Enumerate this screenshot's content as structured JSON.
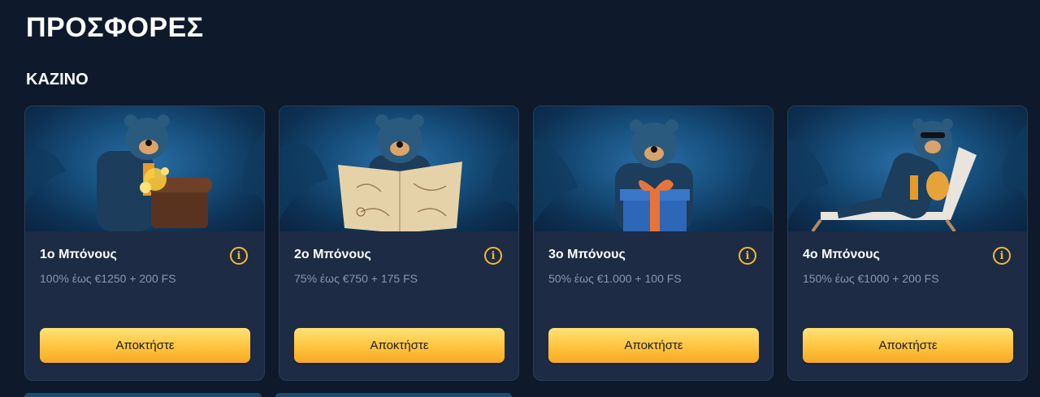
{
  "page": {
    "title": "ΠΡΟΣΦΟΡΕΣ"
  },
  "section": {
    "title": "ΚΑΖΙΝΟ"
  },
  "colors": {
    "background": "#0e1a2b",
    "card": "#1d2b45",
    "accent": "#f5b82e",
    "button_top": "#ffe277",
    "button_bottom": "#f7a823"
  },
  "cards": [
    {
      "title": "1ο Μπόνους",
      "description": "100% έως €1250 + 200 FS",
      "button_label": "Αποκτήστε",
      "image_icon": "bear-with-treasure-chest",
      "info_icon": "info-icon"
    },
    {
      "title": "2ο Μπόνους",
      "description": "75% έως €750 + 175 FS",
      "button_label": "Αποκτήστε",
      "image_icon": "bear-with-treasure-map",
      "info_icon": "info-icon"
    },
    {
      "title": "3ο Μπόνους",
      "description": "50% έως €1.000 + 100 FS",
      "button_label": "Αποκτήστε",
      "image_icon": "bear-with-gift-box",
      "info_icon": "info-icon"
    },
    {
      "title": "4ο Μπόνους",
      "description": "150% έως €1000 + 200 FS",
      "button_label": "Αποκτήστε",
      "image_icon": "bear-on-sunlounger-with-honey",
      "info_icon": "info-icon"
    }
  ],
  "info_glyph": "i"
}
